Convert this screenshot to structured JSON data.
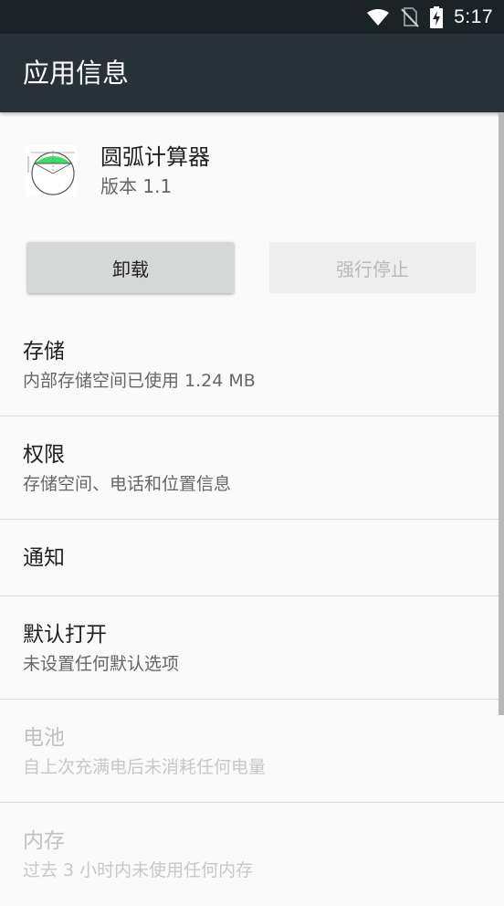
{
  "status_bar": {
    "time": "5:17",
    "icons": [
      "wifi-icon",
      "no-sim-icon",
      "battery-charging-icon"
    ]
  },
  "app_bar": {
    "title": "应用信息"
  },
  "app": {
    "name": "圆弧计算器",
    "version": "版本 1.1",
    "icon": "arc-calculator-app-icon"
  },
  "buttons": {
    "uninstall": "卸载",
    "force_stop": "强行停止"
  },
  "settings": [
    {
      "title": "存储",
      "summary": "内部存储空间已使用 1.24 MB",
      "enabled": true
    },
    {
      "title": "权限",
      "summary": "存储空间、电话和位置信息",
      "enabled": true
    },
    {
      "title": "通知",
      "summary": "",
      "enabled": true
    },
    {
      "title": "默认打开",
      "summary": "未设置任何默认选项",
      "enabled": true
    },
    {
      "title": "电池",
      "summary": "自上次充满电后未消耗任何电量",
      "enabled": false
    },
    {
      "title": "内存",
      "summary": "过去 3 小时内未使用任何内存",
      "enabled": false
    }
  ],
  "colors": {
    "status_bar": "#1c2327",
    "app_bar": "#263238",
    "background": "#fafafa",
    "primary_text": "#212121",
    "secondary_text": "#666666",
    "disabled_text": "#c2c2c2",
    "icon_accent": "#3ddc6a"
  }
}
